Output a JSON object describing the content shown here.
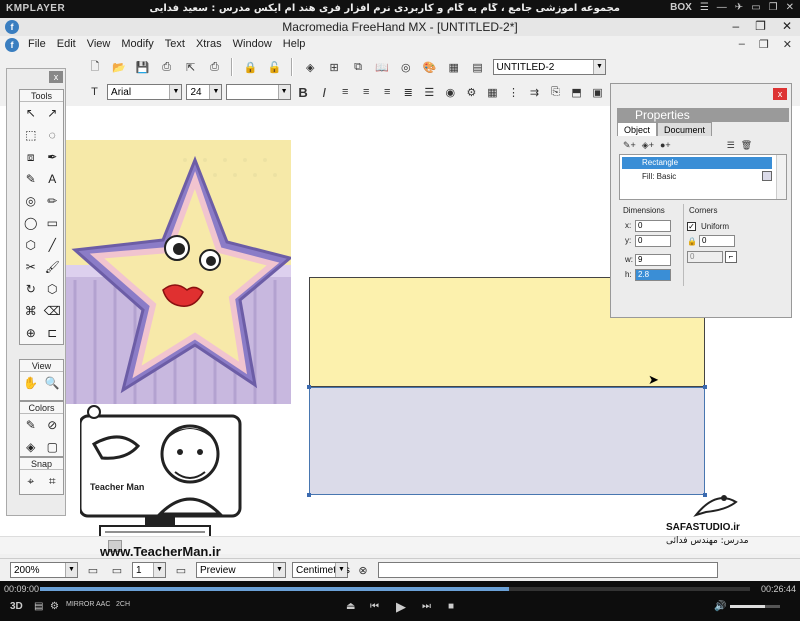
{
  "player": {
    "logo": "KMPLAYER",
    "title": "مجموعه آموزشی جامع ، گام به گام و کاربردی نرم افزار فری هند ام ایکس  مدرس : سعید فدایی (تیچرمن) گروه آموزشی پادشاه گرافیست ها",
    "box_label": "BOX",
    "time_elapsed": "00:09:00",
    "time_total": "00:26:44",
    "progress": 0.66,
    "volume": 0.7,
    "badges": [
      "3D",
      "MIRROR",
      "AAC",
      "2CH"
    ]
  },
  "app": {
    "title": "Macromedia FreeHand MX - [UNTITLED-2*]",
    "menu": [
      "File",
      "Edit",
      "View",
      "Modify",
      "Text",
      "Xtras",
      "Window",
      "Help"
    ],
    "doc_name": "UNTITLED-2",
    "font_name": "Arial",
    "font_size": "24"
  },
  "tools": {
    "title": "Tools",
    "view_title": "View",
    "colors_title": "Colors",
    "snap_title": "Snap",
    "close": "x"
  },
  "properties": {
    "title": "Properties",
    "tab_object": "Object",
    "tab_document": "Document",
    "row_rectangle": "Rectangle",
    "row_fill": "Fill: Basic",
    "dimensions_label": "Dimensions",
    "corners_label": "Corners",
    "x_label": "x:",
    "x_value": "0",
    "y_label": "y:",
    "y_value": "0",
    "w_label": "w:",
    "w_value": "9",
    "h_label": "h:",
    "h_value": "2.8",
    "uniform_label": "Uniform",
    "corner_value": "0",
    "corner_value2": "0",
    "close": "x"
  },
  "status": {
    "zoom": "200%",
    "page": "1",
    "preview": "Preview",
    "units": "Centimeters"
  },
  "watermark": {
    "teacherman_url": "www.TeacherMan.ir",
    "teacherman_caption": "Teacher Man",
    "safa_name": "SAFASTUDIO.ir",
    "safa_caption": "مدرس: مهندس فدائی"
  },
  "colors": {
    "yellow_rect": "#fcf1ad",
    "purple_rect": "#dbdbe9",
    "selection": "#3a8ed6"
  }
}
